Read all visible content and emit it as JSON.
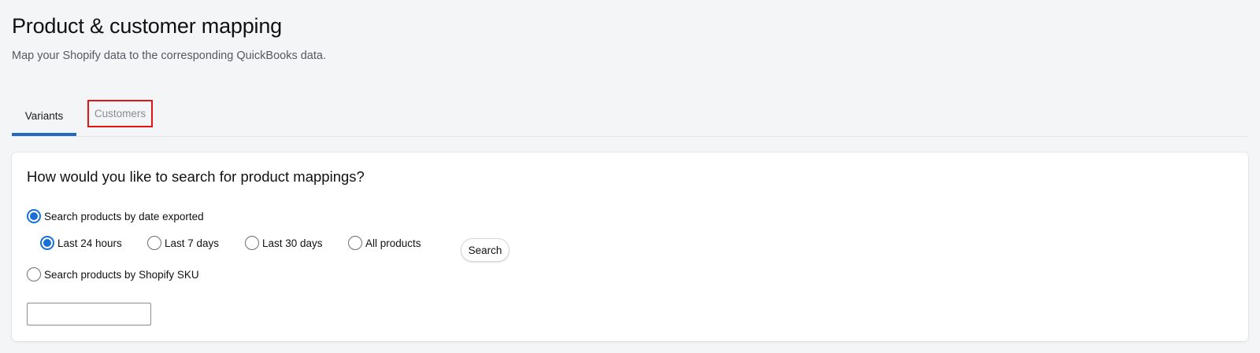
{
  "header": {
    "title": "Product & customer mapping",
    "subtitle": "Map your Shopify data to the corresponding QuickBooks data."
  },
  "tabs": [
    {
      "label": "Variants",
      "selected": true
    },
    {
      "label": "Customers",
      "selected": false
    }
  ],
  "search_card": {
    "title": "How would you like to search for product mappings?",
    "by_date_label": "Search products by date exported",
    "by_date_selected": true,
    "date_options": [
      {
        "label": "Last 24 hours",
        "selected": true
      },
      {
        "label": "Last 7 days",
        "selected": false
      },
      {
        "label": "Last 30 days",
        "selected": false
      },
      {
        "label": "All products",
        "selected": false
      }
    ],
    "search_button_label": "Search",
    "by_sku_label": "Search products by Shopify SKU",
    "by_sku_selected": false,
    "sku_input_value": "",
    "sku_input_placeholder": ""
  },
  "colors": {
    "accent": "#1a6fd6",
    "tab_underline": "#2469c0",
    "highlight_box": "#e01515",
    "background": "#f4f5f7"
  }
}
